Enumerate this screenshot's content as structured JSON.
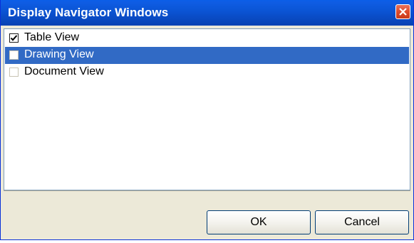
{
  "window": {
    "title": "Display Navigator Windows"
  },
  "list": {
    "items": [
      {
        "label": "Table View",
        "checked": true,
        "selected": false
      },
      {
        "label": "Drawing View",
        "checked": false,
        "selected": true
      },
      {
        "label": "Document View",
        "checked": false,
        "selected": false
      }
    ]
  },
  "buttons": {
    "ok_label": "OK",
    "cancel_label": "Cancel"
  },
  "colors": {
    "titlebar": "#0a4bc4",
    "selection": "#316ac5",
    "close": "#dd4b2c"
  }
}
